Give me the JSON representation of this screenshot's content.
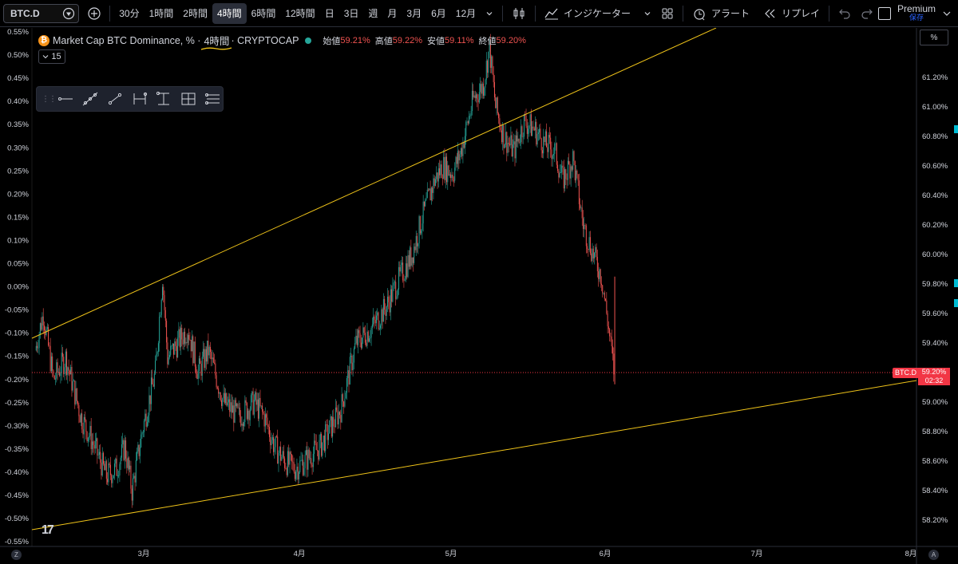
{
  "toolbar": {
    "symbol": "BTC.D",
    "timeframes": [
      "30分",
      "1時間",
      "2時間",
      "4時間",
      "6時間",
      "12時間",
      "日",
      "3日",
      "週",
      "月",
      "3月",
      "6月",
      "12月"
    ],
    "active_timeframe_index": 3,
    "indicators_label": "インジケーター",
    "alert_label": "アラート",
    "replay_label": "リプレイ",
    "premium_label": "Premium",
    "save_label": "保存"
  },
  "legend": {
    "title": "Market Cap BTC Dominance, % ·",
    "timeframe": "4時間",
    "exchange": "· CRYPTOCAP",
    "open_label": "始値",
    "open_value": "59.21%",
    "high_label": "高値",
    "high_value": "59.22%",
    "low_label": "安値",
    "low_value": "59.11%",
    "close_label": "終値",
    "close_value": "59.20%",
    "collapse_count": "15"
  },
  "left_axis": [
    "0.55%",
    "0.50%",
    "0.45%",
    "0.40%",
    "0.35%",
    "0.30%",
    "0.25%",
    "0.20%",
    "0.15%",
    "0.10%",
    "0.05%",
    "0.00%",
    "-0.05%",
    "-0.10%",
    "-0.15%",
    "-0.20%",
    "-0.25%",
    "-0.30%",
    "-0.35%",
    "-0.40%",
    "-0.45%",
    "-0.50%",
    "-0.55%"
  ],
  "right_axis": [
    "61.20%",
    "61.00%",
    "60.80%",
    "60.60%",
    "60.40%",
    "60.20%",
    "60.00%",
    "59.80%",
    "59.60%",
    "59.40%",
    "59.00%",
    "58.80%",
    "58.60%",
    "58.40%",
    "58.20%"
  ],
  "x_axis": [
    "3月",
    "4月",
    "5月",
    "6月",
    "7月",
    "8月"
  ],
  "price_tag": {
    "symbol": "BTC.D",
    "price": "59.20%",
    "countdown": "02:32"
  },
  "percent_button": "%",
  "logo": "17",
  "colors": {
    "up": "#26a69a",
    "down": "#ef5350",
    "trend": "#f0c419",
    "background": "#000000",
    "price_line": "#f23645"
  },
  "chart_data": {
    "type": "candlestick",
    "symbol": "BTC.D",
    "y_range_right": [
      58.1,
      61.5
    ],
    "last_price": 59.2,
    "x_labels": [
      "3月",
      "4月",
      "5月",
      "6月",
      "7月",
      "8月"
    ],
    "trend_lines": [
      {
        "name": "upper",
        "from_date": "2024-02-10",
        "from_price": 59.39,
        "to_date": "2024-07-15",
        "to_price": 61.75
      },
      {
        "name": "lower",
        "from_date": "2024-02-10",
        "from_price": 58.15,
        "to_date": "2024-08-10",
        "to_price": 59.15
      }
    ],
    "path": [
      [
        0,
        59.35
      ],
      [
        8,
        59.6
      ],
      [
        18,
        59.15
      ],
      [
        30,
        59.3
      ],
      [
        45,
        58.9
      ],
      [
        55,
        58.75
      ],
      [
        70,
        58.5
      ],
      [
        80,
        58.55
      ],
      [
        88,
        58.7
      ],
      [
        95,
        58.4
      ],
      [
        105,
        58.8
      ],
      [
        118,
        59.2
      ],
      [
        125,
        59.85
      ],
      [
        130,
        59.3
      ],
      [
        140,
        59.4
      ],
      [
        150,
        59.5
      ],
      [
        160,
        59.2
      ],
      [
        170,
        59.35
      ],
      [
        185,
        59.0
      ],
      [
        200,
        58.9
      ],
      [
        215,
        59.0
      ],
      [
        225,
        58.9
      ],
      [
        235,
        58.7
      ],
      [
        245,
        58.6
      ],
      [
        255,
        58.55
      ],
      [
        265,
        58.6
      ],
      [
        280,
        58.7
      ],
      [
        300,
        58.95
      ],
      [
        315,
        59.4
      ],
      [
        330,
        59.5
      ],
      [
        345,
        59.65
      ],
      [
        355,
        59.8
      ],
      [
        370,
        60.0
      ],
      [
        380,
        60.25
      ],
      [
        392,
        60.5
      ],
      [
        400,
        60.6
      ],
      [
        410,
        60.55
      ],
      [
        418,
        60.7
      ],
      [
        430,
        61.05
      ],
      [
        440,
        61.15
      ],
      [
        446,
        61.4
      ],
      [
        452,
        61.0
      ],
      [
        460,
        60.8
      ],
      [
        470,
        60.7
      ],
      [
        480,
        60.9
      ],
      [
        490,
        60.85
      ],
      [
        500,
        60.75
      ],
      [
        510,
        60.7
      ],
      [
        518,
        60.5
      ],
      [
        528,
        60.65
      ],
      [
        538,
        60.2
      ],
      [
        548,
        60.0
      ],
      [
        556,
        59.85
      ],
      [
        562,
        59.55
      ],
      [
        568,
        59.22
      ]
    ]
  }
}
